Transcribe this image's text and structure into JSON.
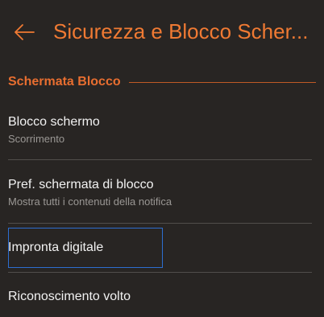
{
  "header": {
    "back_icon": "arrow-left-icon",
    "title": "Sicurezza e Blocco Scher..."
  },
  "section": {
    "title": "Schermata Blocco"
  },
  "items": [
    {
      "title": "Blocco schermo",
      "subtitle": "Scorrimento"
    },
    {
      "title": "Pref. schermata di blocco",
      "subtitle": "Mostra tutti i contenuti della notifica"
    },
    {
      "title": "Impronta digitale",
      "subtitle": ""
    },
    {
      "title": "Riconoscimento volto",
      "subtitle": ""
    }
  ],
  "colors": {
    "background": "#282523",
    "accent": "#f07a33",
    "focus": "#2d6ed0"
  }
}
